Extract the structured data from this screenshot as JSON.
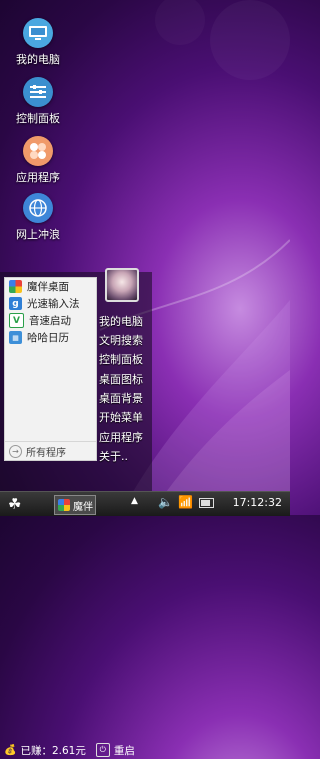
{
  "desktop": {
    "icons": [
      {
        "label": "我的电脑",
        "icon": "computer-icon"
      },
      {
        "label": "控制面板",
        "icon": "control-panel-icon"
      },
      {
        "label": "应用程序",
        "icon": "apps-icon"
      },
      {
        "label": "网上冲浪",
        "icon": "globe-icon"
      }
    ]
  },
  "start_menu": {
    "apps": [
      {
        "label": "魔伴桌面",
        "icon": "mobandesk-icon"
      },
      {
        "label": "光速输入法",
        "icon": "input-method-icon"
      },
      {
        "label": "音速启动",
        "icon": "launcher-icon"
      },
      {
        "label": "哈哈日历",
        "icon": "calendar-icon"
      }
    ],
    "all_programs": "所有程序",
    "right_items": [
      "我的电脑",
      "文明搜索",
      "控制面板",
      "桌面图标",
      "桌面背景",
      "开始菜单",
      "应用程序",
      "关于.."
    ],
    "earned": "已赚：2.61元",
    "restart": "重启"
  },
  "taskbar": {
    "app_label": "魔伴",
    "clock": "17:12:32"
  }
}
